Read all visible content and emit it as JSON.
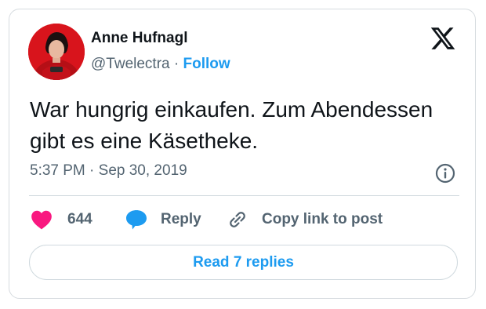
{
  "author": {
    "name": "Anne Hufnagl",
    "handle": "@Twelectra",
    "separator": "·",
    "follow_label": "Follow",
    "avatar_icon": "profile-photo"
  },
  "tweet": {
    "line1": "War hungrig einkaufen. Zum Abendessen",
    "line2": "gibt es eine Käsetheke.",
    "time": "5:37 PM",
    "date_separator": "·",
    "date": "Sep 30, 2019"
  },
  "actions": {
    "like_count": "644",
    "reply_label": "Reply",
    "copy_label": "Copy link to post"
  },
  "footer": {
    "read_replies_label": "Read 7 replies"
  },
  "icons": {
    "logo": "x-logo-icon",
    "info": "info-icon",
    "like": "heart-icon",
    "reply": "speech-bubble-icon",
    "copy": "link-icon"
  },
  "colors": {
    "accent": "#1d9bf0",
    "like": "#f91880",
    "muted": "#536471",
    "text": "#0f1419"
  }
}
